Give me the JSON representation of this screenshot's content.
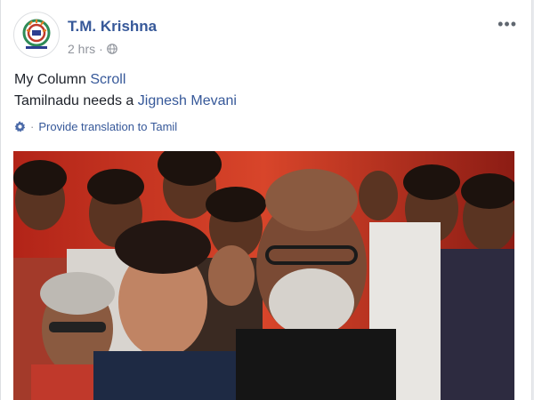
{
  "post": {
    "author": "T.M. Krishna",
    "time": "2 hrs",
    "time_sep": "·",
    "privacy_icon": "globe-icon",
    "more_label": "•••",
    "text": {
      "line1_static": "My Column ",
      "line1_link": "Scroll",
      "line2_static": "Tamilnadu needs a ",
      "line2_link": "Jignesh Mevani"
    },
    "translation": {
      "icon": "gear-icon",
      "sep": "·",
      "label": "Provide translation to Tamil"
    },
    "photo": {
      "description_icon": "photo-crowd"
    }
  },
  "colors": {
    "author_link": "#365899",
    "text": "#1d2129",
    "muted": "#90949c",
    "background": "#e9ebee"
  }
}
